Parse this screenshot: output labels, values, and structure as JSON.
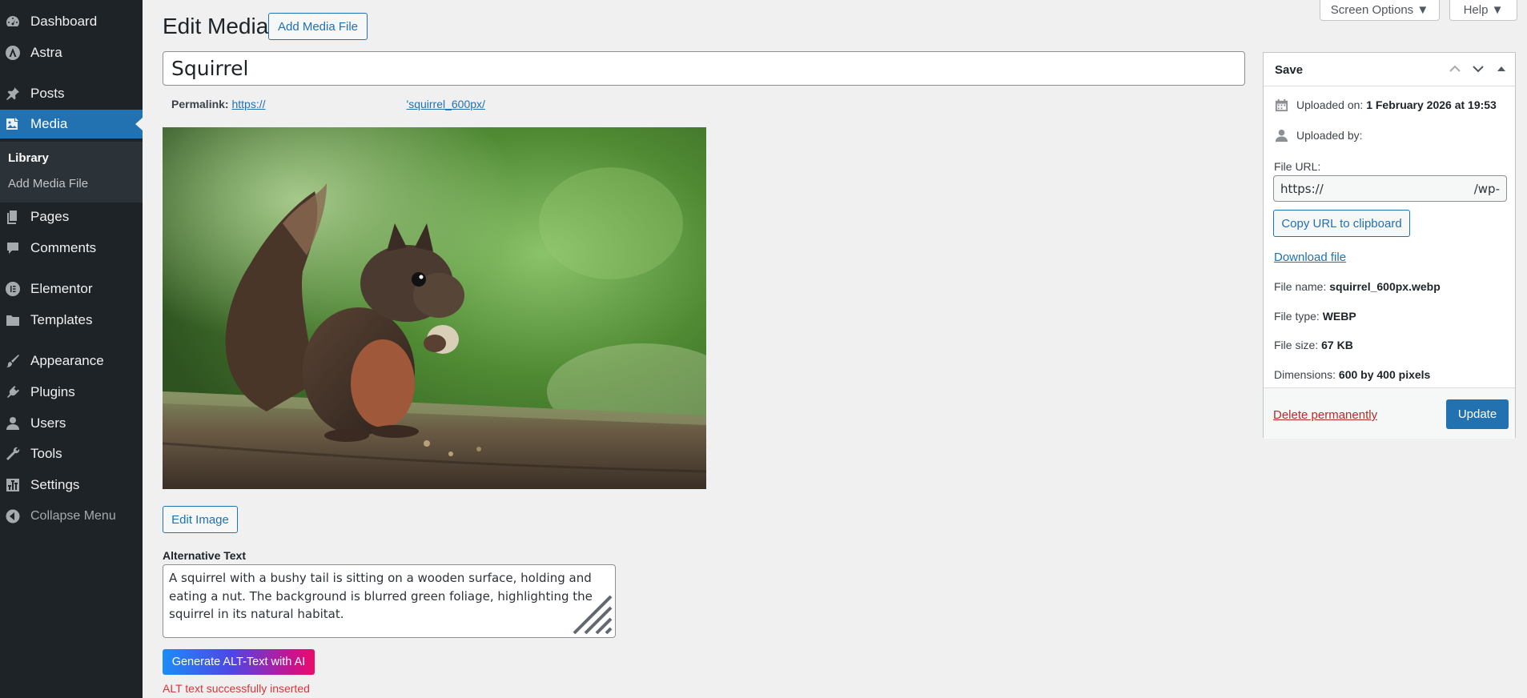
{
  "sidebar": {
    "items": [
      {
        "label": "Dashboard",
        "icon": "dashboard-icon"
      },
      {
        "label": "Astra",
        "icon": "astra-icon"
      },
      {
        "label": "Posts",
        "icon": "pushpin-icon"
      },
      {
        "label": "Media",
        "icon": "media-icon"
      },
      {
        "label": "Pages",
        "icon": "pages-icon"
      },
      {
        "label": "Comments",
        "icon": "comment-icon"
      },
      {
        "label": "Elementor",
        "icon": "elementor-icon"
      },
      {
        "label": "Templates",
        "icon": "folder-icon"
      },
      {
        "label": "Appearance",
        "icon": "paintbrush-icon"
      },
      {
        "label": "Plugins",
        "icon": "plugin-icon"
      },
      {
        "label": "Users",
        "icon": "user-icon"
      },
      {
        "label": "Tools",
        "icon": "wrench-icon"
      },
      {
        "label": "Settings",
        "icon": "settings-icon"
      },
      {
        "label": "Collapse Menu",
        "icon": "collapse-icon"
      }
    ],
    "submenu": [
      "Library",
      "Add Media File"
    ]
  },
  "top_tabs": {
    "screen_options": "Screen Options ▼",
    "help": "Help ▼"
  },
  "header": {
    "title": "Edit Media",
    "add_button": "Add Media File"
  },
  "media": {
    "title_value": "Squirrel",
    "permalink_label": "Permalink:",
    "permalink_start": "https://",
    "permalink_end": "'squirrel_600px/",
    "image_alt": "A squirrel with a bushy tail is sitting on a wooden surface"
  },
  "edit_image_button": "Edit Image",
  "alt_text": {
    "label": "Alternative Text",
    "value": "A squirrel with a bushy tail is sitting on a wooden surface, holding and eating a nut. The background is blurred green foliage, highlighting the squirrel in its natural habitat.",
    "generate_button": "Generate ALT-Text with AI",
    "status": "ALT text successfully inserted"
  },
  "savebox": {
    "title": "Save",
    "uploaded_on_label": "Uploaded on:",
    "uploaded_on_value": "1 February 2026 at 19:53",
    "uploaded_by_label": "Uploaded by:",
    "file_url_label": "File URL:",
    "file_url_start": "https://",
    "file_url_end": "/wp-",
    "copy_button": "Copy URL to clipboard",
    "download_link": "Download file",
    "file_name_label": "File name:",
    "file_name_value": "squirrel_600px.webp",
    "file_type_label": "File type:",
    "file_type_value": "WEBP",
    "file_size_label": "File size:",
    "file_size_value": "67 KB",
    "dimensions_label": "Dimensions:",
    "dimensions_value": "600 by 400 pixels",
    "delete_link": "Delete permanently",
    "update_button": "Update"
  },
  "colors": {
    "sidebar_bg": "#1d2327",
    "accent": "#2271b1",
    "danger": "#d63638"
  }
}
